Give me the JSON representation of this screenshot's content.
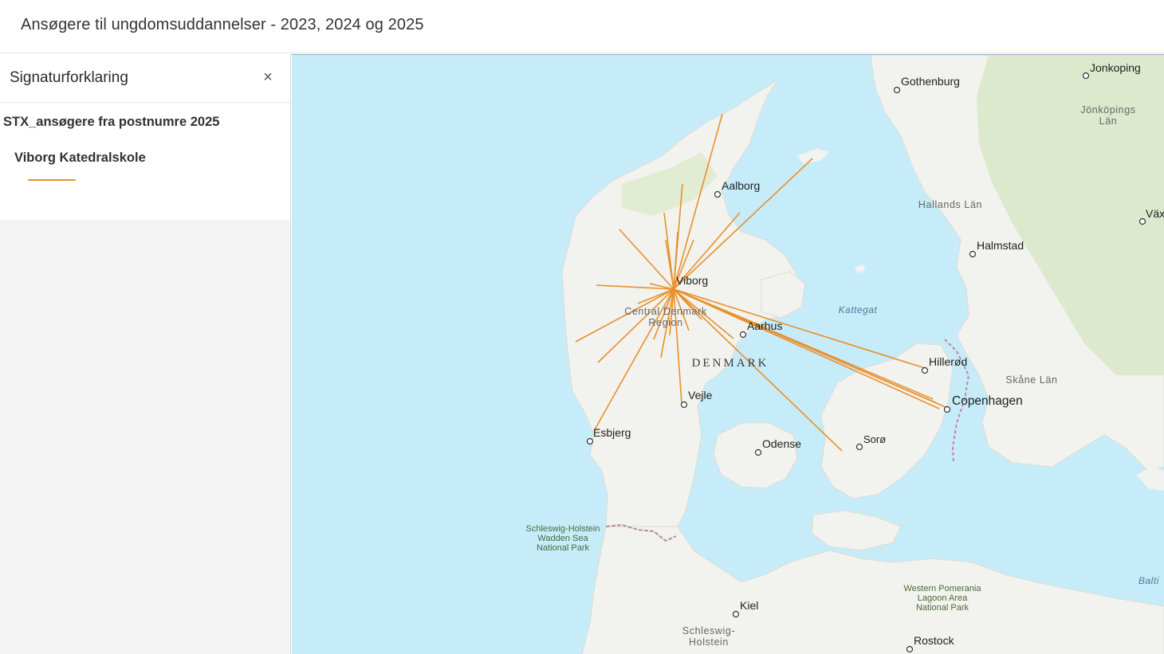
{
  "header": {
    "title": "Ansøgere til ungdomsuddannelser - 2023, 2024 og 2025"
  },
  "legend": {
    "title": "Signaturforklaring",
    "close_icon": "close-icon",
    "layer_name": "STX_ansøgere fra postnumre 2025",
    "symbol_label": "Viborg Katedralskole",
    "symbol_color": "#e8902c"
  },
  "map": {
    "colors": {
      "water": "#c6ecfa",
      "land": "#f2f2ee",
      "green": "#dde9cd",
      "flow": "#e8902c",
      "border": "#b98aa8"
    },
    "cities": [
      {
        "name": "Gothenburg"
      },
      {
        "name": "Jonkoping"
      },
      {
        "name": "Aalborg"
      },
      {
        "name": "Viborg"
      },
      {
        "name": "Aarhus"
      },
      {
        "name": "Halmstad"
      },
      {
        "name": "Hillerød"
      },
      {
        "name": "Copenhagen"
      },
      {
        "name": "Vejle"
      },
      {
        "name": "Esbjerg"
      },
      {
        "name": "Odense"
      },
      {
        "name": "Sorø"
      },
      {
        "name": "Kiel"
      },
      {
        "name": "Rostock"
      },
      {
        "name": "Växj"
      }
    ],
    "regions": {
      "jonkoping_lan": [
        "Jönköpings",
        "Län"
      ],
      "hallands_lan": "Hallands Län",
      "skane_lan": "Skåne Län",
      "central_region": [
        "Central Denmark",
        "Region"
      ],
      "schleswig_holstein": [
        "Schleswig-",
        "Holstein"
      ],
      "western_pomerania": [
        "Western Pomerania",
        "Lagoon Area",
        "National Park"
      ],
      "wadden_sea": [
        "Schleswig-Holstein",
        "Wadden Sea",
        "National Park"
      ]
    },
    "water_labels": {
      "kattegat": "Kattegat",
      "baltic": "Balti"
    },
    "country": "DENMARK"
  }
}
